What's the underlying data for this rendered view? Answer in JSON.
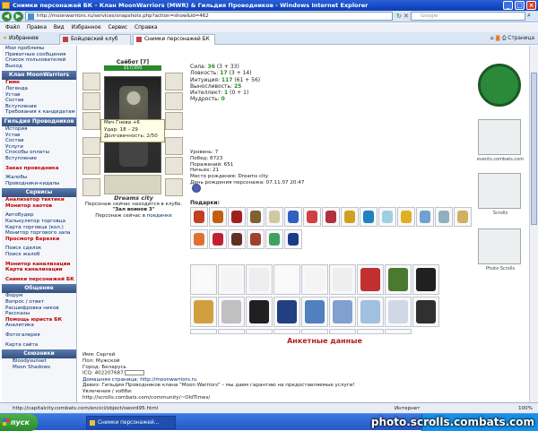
{
  "window": {
    "title": "Снимки персонажей БК – Клан MoonWarriors (MWR) & Гильдия Проводников - Windows Internet Explorer",
    "url": "http://moonwarriors.ru/services/snapshots.php?action=show&id=462",
    "search_placeholder": "Google"
  },
  "menu": [
    "Файл",
    "Правка",
    "Вид",
    "Избранное",
    "Сервис",
    "Справка"
  ],
  "tabs": {
    "favorites": "Избранное",
    "items": [
      {
        "label": "Бойцовский клуб",
        "active": false
      },
      {
        "label": "Снимки персонажей БК",
        "active": true
      }
    ],
    "page_menu": "Страница"
  },
  "sidebar": {
    "top_links": [
      "Мои проблемы",
      "Приватные сообщения",
      "Список пользователей",
      "Выход"
    ],
    "sections": [
      {
        "title": "Клан MoonWarriors",
        "links": [
          {
            "label": "Гимн",
            "red": true
          },
          {
            "label": "Легенда"
          },
          {
            "label": "Устав"
          },
          {
            "label": "Состав"
          },
          {
            "label": "Вступление"
          },
          {
            "label": "Требования к кандидатам"
          }
        ]
      },
      {
        "title": "Гильдия Проводников",
        "links": [
          {
            "label": "История"
          },
          {
            "label": "Устав"
          },
          {
            "label": "Состав"
          },
          {
            "label": "Услуги"
          },
          {
            "label": "Способы оплаты"
          },
          {
            "label": "Вступление"
          },
          {
            "label": ""
          },
          {
            "label": "Заказ проводника",
            "red": true
          },
          {
            "label": ""
          },
          {
            "label": "Жалобы"
          },
          {
            "label": "Проводники-кидалы"
          }
        ]
      },
      {
        "title": "Сервисы",
        "links": [
          {
            "label": "Анализатор тактики",
            "red": true
          },
          {
            "label": "Монитор хаотов",
            "red": true
          },
          {
            "label": ""
          },
          {
            "label": "Автобудер"
          },
          {
            "label": "Калькулятор торговца"
          },
          {
            "label": "Карта торговца (кол.)"
          },
          {
            "label": "Монитор торгового зала"
          },
          {
            "label": "Просмотр Березки",
            "red": true
          },
          {
            "label": ""
          },
          {
            "label": "Поиск сделок"
          },
          {
            "label": "Поиск жалоб"
          },
          {
            "label": ""
          },
          {
            "label": "Монитор канализации",
            "red": true
          },
          {
            "label": "Карта канализации",
            "red": true
          },
          {
            "label": ""
          },
          {
            "label": "Снимки персонажей БК",
            "red": true
          }
        ]
      },
      {
        "title": "Общение",
        "links": [
          {
            "label": "Форум"
          },
          {
            "label": "Вопрос / ответ"
          },
          {
            "label": "Расшифровка ников"
          },
          {
            "label": "Рассказы"
          },
          {
            "label": "Помощь юриста БК",
            "red": true
          },
          {
            "label": "Аналитика"
          },
          {
            "label": ""
          },
          {
            "label": "Фотогалерея"
          },
          {
            "label": ""
          },
          {
            "label": "Карта сайта"
          }
        ]
      },
      {
        "title": "Союзники",
        "links": [
          {
            "label": "Bloodysunset"
          },
          {
            "label": "Moon Shadows"
          }
        ]
      }
    ]
  },
  "character": {
    "name": "Сайбот [7]",
    "hp": "317/350",
    "tooltip": [
      "Меч Гнева +6",
      "Удар: 18 – 29",
      "Долговечность: 2/50"
    ],
    "location_name": "Dreams city",
    "location_line1": "Персонаж сейчас находится в клубе.",
    "location_line2": "\"Зал воинов 3\"",
    "location_line3": "Персонаж сейчас в",
    "location_link": "поединке"
  },
  "stats": [
    {
      "label": "Сила:",
      "value": "36",
      "extra": "(3 + 33)"
    },
    {
      "label": "Ловкость:",
      "value": "17",
      "extra": "(3 + 14)"
    },
    {
      "label": "Интуиция:",
      "value": "117",
      "extra": "(61 + 56)"
    },
    {
      "label": "Выносливость:",
      "value": "25",
      "extra": ""
    },
    {
      "label": "Интеллект:",
      "value": "1",
      "extra": "(0 + 1)"
    },
    {
      "label": "Мудрость:",
      "value": "0",
      "extra": ""
    }
  ],
  "info": [
    "Уровень: 7",
    "Побед: 8723",
    "Поражений: 651",
    "Ничьих: 21",
    "Место рождения: Dreams city",
    "День рождения персонажа: 07.11.07 20:47"
  ],
  "gifts_label": "Подарки:",
  "gift_colors": {
    "row1": [
      "#c04020",
      "#c06010",
      "#a02020",
      "#806030",
      "#d0c8a0",
      "#3060c0",
      "#d04040",
      "#b03040",
      "#d0a020",
      "#2080c0",
      "#a0d0e0",
      "#e0b020",
      "#70a0d0",
      "#90b0c0",
      "#d0b060"
    ],
    "row2": [
      "#e07030",
      "#c02030",
      "#603020",
      "#a04030",
      "#40a060",
      "#1a3a8a"
    ]
  },
  "cards_colors": {
    "row1": [
      "#fafafa",
      "#f4f4f4",
      "#eeeeee",
      "#fafafa",
      "#f4f4f4",
      "#eeeeee",
      "#c03030",
      "#4a7a30",
      "#202020"
    ],
    "row2": [
      "#d0a040",
      "#c0c0c0",
      "#202020",
      "#204080",
      "#5080c0",
      "#80a0d0",
      "#a0c0e0",
      "#d0d8e8",
      "#303030"
    ],
    "row3": [
      "#3050a0",
      "#90a0b0",
      "#303030",
      "#c0d0e0",
      "#a0b0c0",
      "#d0d0d8",
      "#c07030",
      "#202020"
    ]
  },
  "anketa_title": "Анкетные данные",
  "anketa": [
    "Имя: Сергей",
    "Пол: Мужской",
    "Город: Беларусь",
    "ICQ: 402207687",
    "Домашняя страница: http://moonwarriors.ru",
    "Девиз: Гильдия Проводников клана \"Moon Warriors\" – мы даем гарантию на предоставляемые услуги!",
    "Увлечения / хобби:",
    "http://scrolls.combats.com/community/~OldTimes/"
  ],
  "right_column": {
    "labels": [
      "events.combats.com",
      "Scrolls",
      "Photo Scrolls"
    ]
  },
  "status": {
    "text": "http://capitalcity.combats.com/encicl/object/sword95.html",
    "zone": "Интернет",
    "zoom": "100%"
  },
  "taskbar": {
    "start": "пуск",
    "item": "Снимки персонажей...",
    "clock": "0:04"
  },
  "watermark": "photo.scrolls.combats.com"
}
